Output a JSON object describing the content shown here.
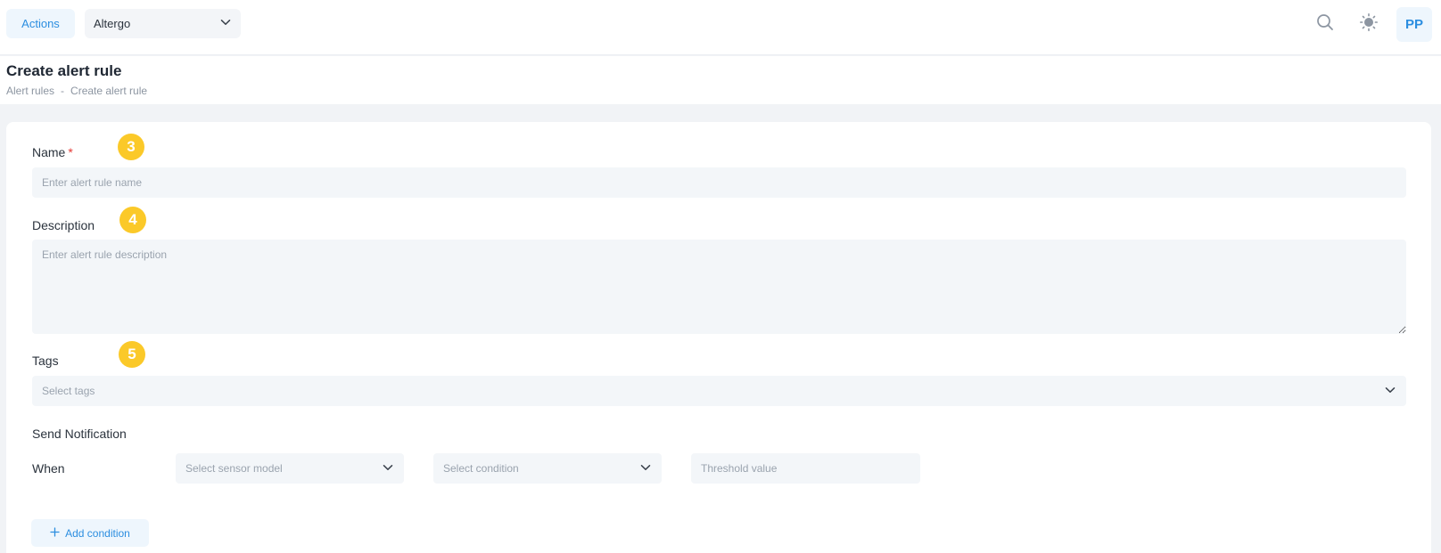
{
  "topbar": {
    "actions_label": "Actions",
    "org_selected": "Altergo",
    "avatar_initials": "PP"
  },
  "header": {
    "title": "Create alert rule",
    "breadcrumb": [
      "Alert rules",
      "Create alert rule"
    ],
    "breadcrumb_sep": "-"
  },
  "form": {
    "name": {
      "label": "Name",
      "required_mark": "*",
      "placeholder": "Enter alert rule name",
      "step": "3"
    },
    "description": {
      "label": "Description",
      "placeholder": "Enter alert rule description",
      "step": "4"
    },
    "tags": {
      "label": "Tags",
      "placeholder": "Select tags",
      "step": "5"
    },
    "notification": {
      "label": "Send Notification",
      "when_label": "When",
      "sensor_placeholder": "Select sensor model",
      "condition_placeholder": "Select condition",
      "threshold_placeholder": "Threshold value",
      "add_condition_label": "Add condition"
    }
  },
  "colors": {
    "accent": "#2c8ee0",
    "badge": "#fbc929",
    "required": "#e53935"
  }
}
